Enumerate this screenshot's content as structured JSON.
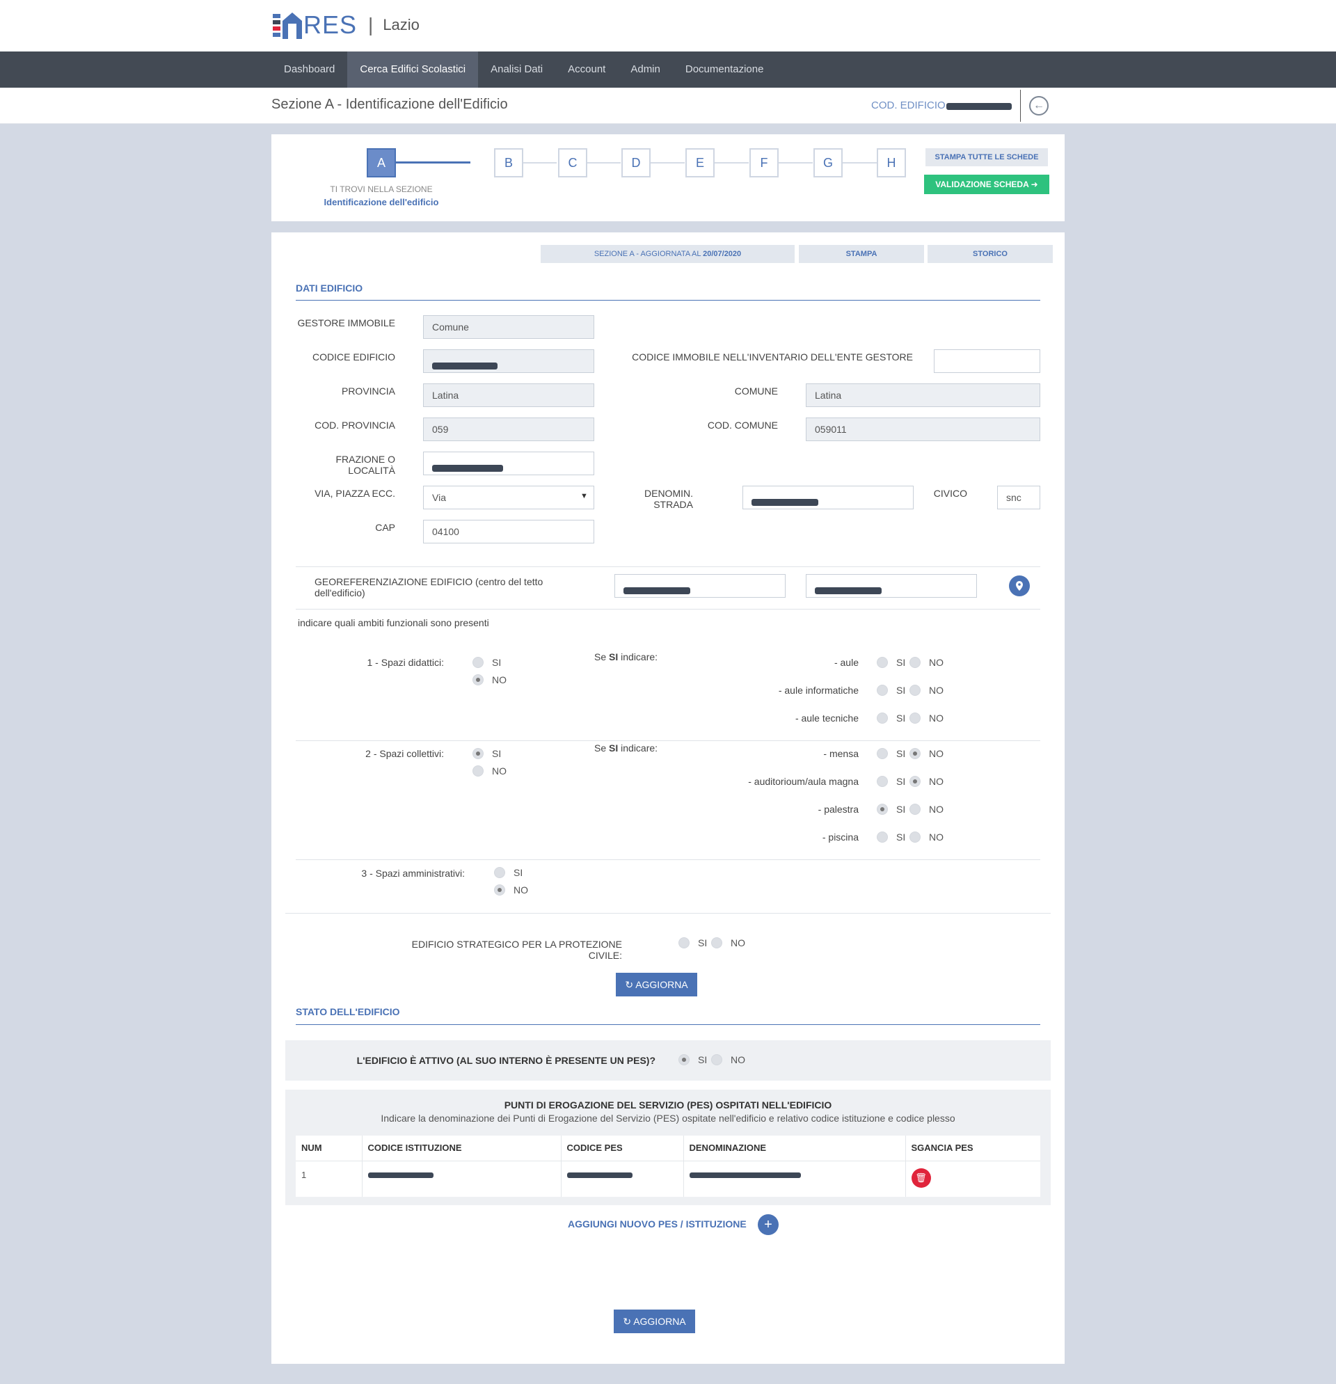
{
  "brand": {
    "name": "RES",
    "region": "Lazio"
  },
  "nav": {
    "items": [
      {
        "label": "Dashboard",
        "active": false
      },
      {
        "label": "Cerca Edifici Scolastici",
        "active": true
      },
      {
        "label": "Analisi Dati",
        "active": false
      },
      {
        "label": "Account",
        "active": false
      },
      {
        "label": "Admin",
        "active": false
      },
      {
        "label": "Documentazione",
        "active": false
      }
    ]
  },
  "header": {
    "title": "Sezione A - Identificazione dell'Edificio",
    "cod_label": "COD. EDIFICIO"
  },
  "steps": {
    "items": [
      "A",
      "B",
      "C",
      "D",
      "E",
      "F",
      "G",
      "H"
    ],
    "active": "A",
    "caption_small": "TI TROVI NELLA SEZIONE",
    "caption_main": "Identificazione dell'edificio",
    "print_all": "STAMPA TUTTE LE SCHEDE",
    "validate": "VALIDAZIONE SCHEDA"
  },
  "toolbar": {
    "updated_prefix": "SEZIONE A - AGGIORNATA AL",
    "updated_date": "20/07/2020",
    "print": "STAMPA",
    "history": "STORICO"
  },
  "dati": {
    "title": "DATI EDIFICIO",
    "gestore_label": "GESTORE IMMOBILE",
    "gestore_value": "Comune",
    "codice_label": "CODICE EDIFICIO",
    "inventario_label": "CODICE IMMOBILE NELL'INVENTARIO DELL'ENTE GESTORE",
    "inventario_value": "",
    "provincia_label": "PROVINCIA",
    "provincia_value": "Latina",
    "comune_label": "COMUNE",
    "comune_value": "Latina",
    "cod_provincia_label": "COD. PROVINCIA",
    "cod_provincia_value": "059",
    "cod_comune_label": "COD. COMUNE",
    "cod_comune_value": "059011",
    "frazione_label": "FRAZIONE O LOCALITÀ",
    "via_label": "VIA, PIAZZA ECC.",
    "via_value": "Via",
    "strada_label": "DENOMIN. STRADA",
    "civico_label": "CIVICO",
    "civico_value": "snc",
    "cap_label": "CAP",
    "cap_value": "04100",
    "geo_label": "GEOREFERENZIAZIONE EDIFICIO (centro del tetto dell'edificio)",
    "ambiti_label": "indicare quali ambiti funzionali sono presenti"
  },
  "labels": {
    "si": "SI",
    "no": "NO",
    "se": "Se",
    "si_bold": "SI",
    "indicare": "indicare:"
  },
  "ambiti": {
    "didattici": {
      "label": "1 - Spazi didattici:",
      "value": "NO",
      "sub": [
        {
          "label": "- aule",
          "value": ""
        },
        {
          "label": "- aule informatiche",
          "value": ""
        },
        {
          "label": "- aule tecniche",
          "value": ""
        }
      ]
    },
    "collettivi": {
      "label": "2 - Spazi collettivi:",
      "value": "SI",
      "sub": [
        {
          "label": "- mensa",
          "value": "NO"
        },
        {
          "label": "- auditorioum/aula magna",
          "value": "NO"
        },
        {
          "label": "- palestra",
          "value": "SI"
        },
        {
          "label": "- piscina",
          "value": ""
        }
      ]
    },
    "amministrativi": {
      "label": "3 - Spazi amministrativi:",
      "value": "NO"
    }
  },
  "strategico": {
    "label": "EDIFICIO STRATEGICO PER LA PROTEZIONE CIVILE:",
    "value": ""
  },
  "update_label": "AGGIORNA",
  "stato": {
    "title": "STATO DELL'EDIFICIO",
    "attivo_label": "L'EDIFICIO È ATTIVO (AL SUO INTERNO È PRESENTE UN PES)?",
    "attivo_value": "SI"
  },
  "pes": {
    "title": "PUNTI DI EROGAZIONE DEL SERVIZIO (PES) OSPITATI NELL'EDIFICIO",
    "subtitle": "Indicare la denominazione dei Punti di Erogazione del Servizio (PES) ospitate nell'edificio e relativo codice istituzione e codice plesso",
    "columns": [
      "NUM",
      "CODICE ISTITUZIONE",
      "CODICE PES",
      "DENOMINAZIONE",
      "SGANCIA PES"
    ],
    "rows": [
      {
        "num": "1"
      }
    ],
    "add_label": "AGGIUNGI NUOVO PES / ISTITUZIONE"
  },
  "colors": {
    "primary": "#4a72b5",
    "nav": "#434a54",
    "success": "#2ec27e",
    "danger": "#e0243b"
  }
}
